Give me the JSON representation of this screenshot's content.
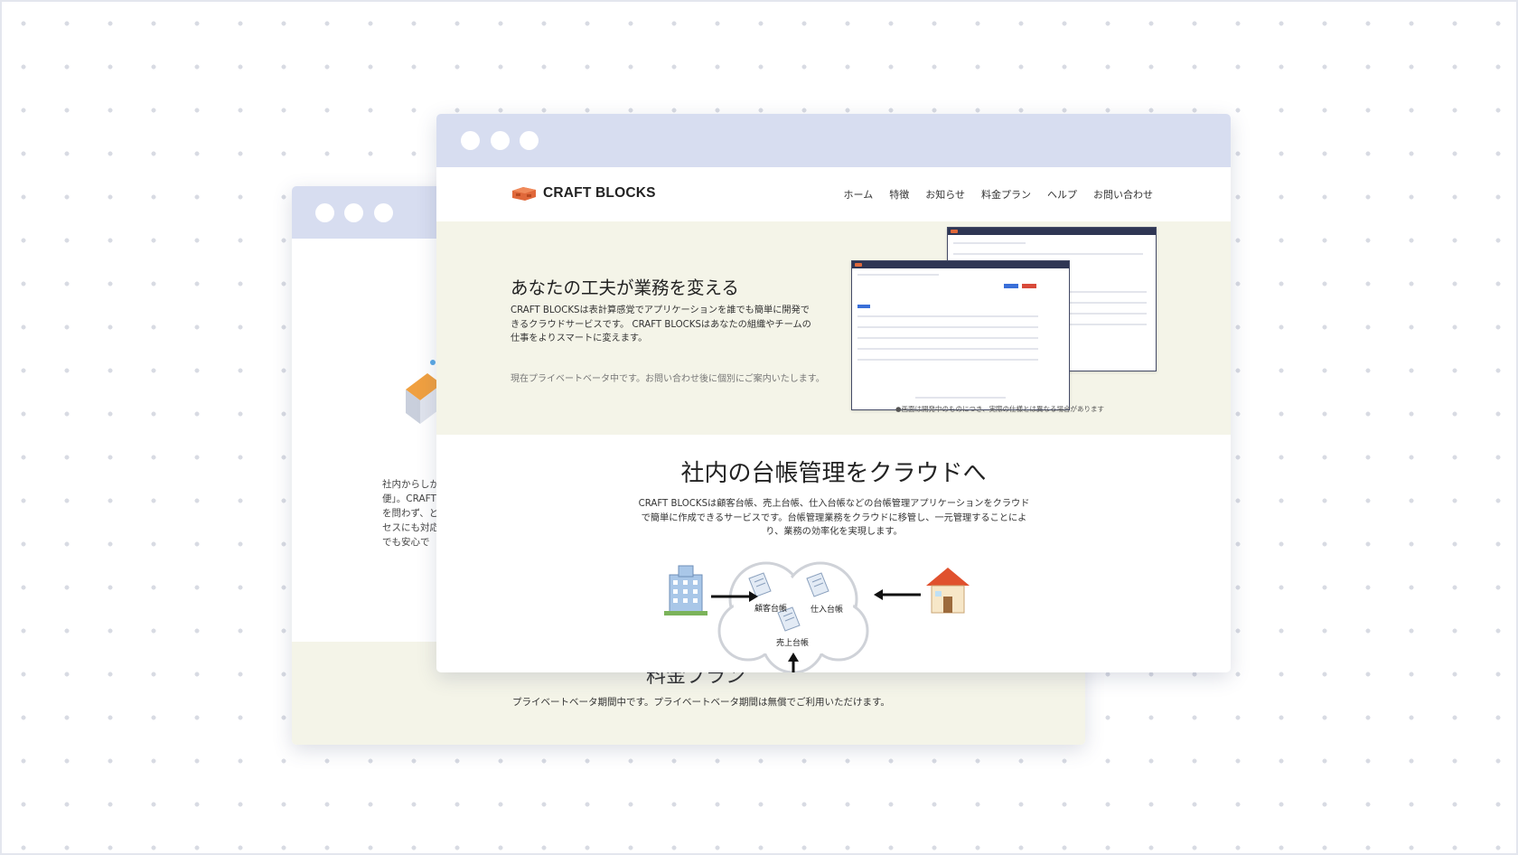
{
  "back_window": {
    "text_lines": [
      "社内からしか",
      "便」。CRAFT",
      "を問わず、と",
      "セスにも対応",
      "でも安心で"
    ],
    "pricing_heading": "料金プラン",
    "pricing_sub": "プライベートベータ期間中です。プライベートベータ期間は無償でご利用いただけます。"
  },
  "front_window": {
    "logo": "CRAFT BLOCKS",
    "nav": [
      "ホーム",
      "特徴",
      "お知らせ",
      "料金プラン",
      "ヘルプ",
      "お問い合わせ"
    ],
    "hero": {
      "title": "あなたの工夫が業務を変える",
      "description": "CRAFT BLOCKSは表計算感覚でアプリケーションを誰でも簡単に開発できるクラウドサービスです。 CRAFT BLOCKSはあなたの組織やチームの仕事をよりスマートに変えます。",
      "note": "現在プライベートベータ中です。お問い合わせ後に個別にご案内いたします。",
      "caption": "●画面は開発中のものにつき、実際の仕様とは異なる場合があります"
    },
    "section": {
      "title": "社内の台帳管理をクラウドへ",
      "description": "CRAFT BLOCKSは顧客台帳、売上台帳、仕入台帳などの台帳管理アプリケーションをクラウドで簡単に作成できるサービスです。台帳管理業務をクラウドに移管し、一元管理することにより、業務の効率化を実現します。"
    },
    "diagram": {
      "labels": [
        "顧客台帳",
        "仕入台帳",
        "売上台帳"
      ]
    }
  },
  "colors": {
    "window_bar": "#d7ddf0",
    "hero_bg": "#f4f4e8",
    "logo_orange": "#e0683a"
  }
}
